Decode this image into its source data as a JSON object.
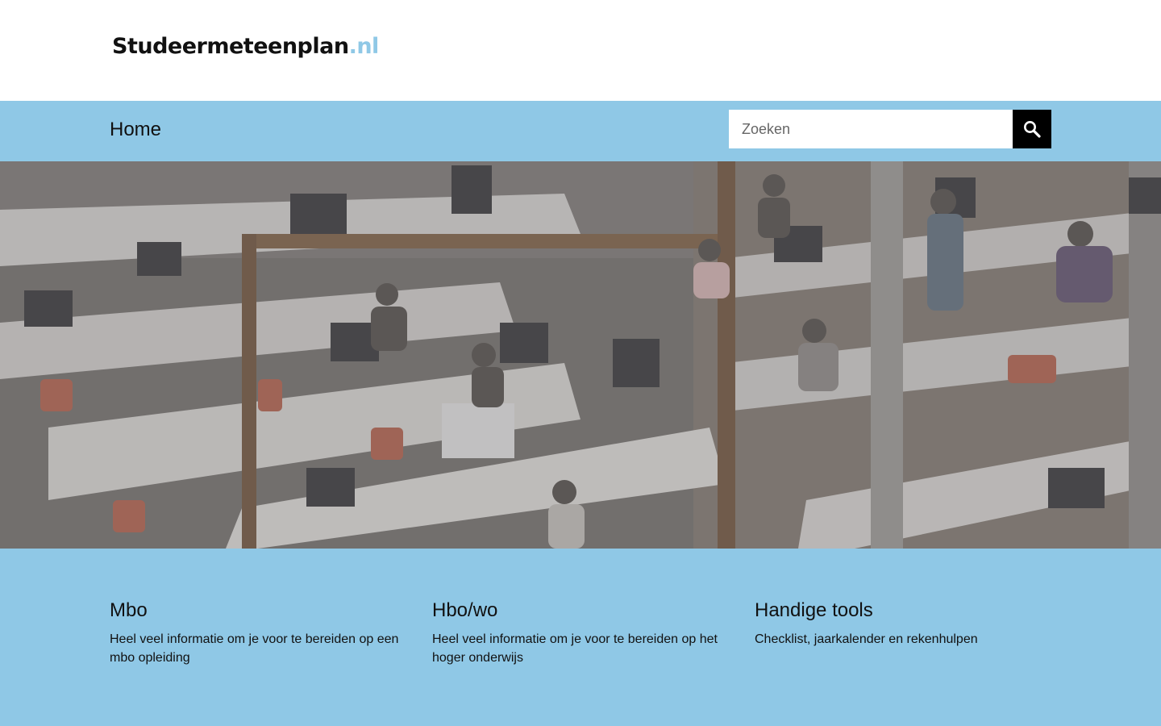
{
  "colors": {
    "accent": "#8fc8e6",
    "search_button": "#000000"
  },
  "header": {
    "logo_name": "Studeermeteenplan",
    "logo_tld": ".nl"
  },
  "nav": {
    "home_label": "Home"
  },
  "search": {
    "placeholder": "Zoeken",
    "value": "",
    "button_icon": "search-icon"
  },
  "hero": {
    "image": "students-working-at-computers-photo"
  },
  "cards": [
    {
      "title": "Mbo",
      "description": "Heel veel informatie om je voor te bereiden op een mbo opleiding"
    },
    {
      "title": "Hbo/wo",
      "description": "Heel veel informatie om je voor te bereiden op het hoger onderwijs"
    },
    {
      "title": "Handige tools",
      "description": "Checklist, jaarkalender en rekenhulpen"
    }
  ]
}
